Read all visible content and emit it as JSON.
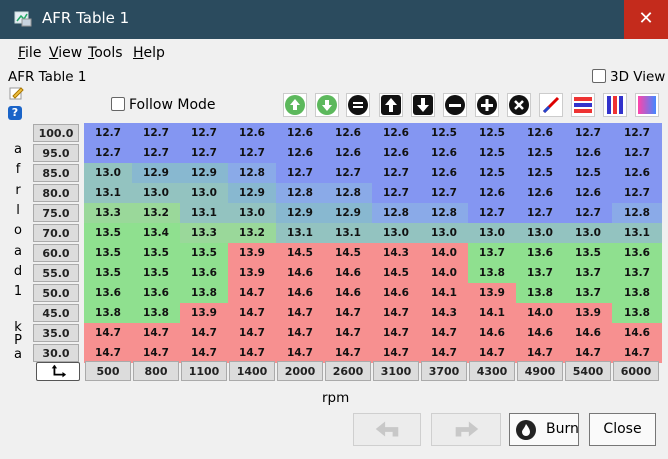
{
  "window": {
    "title": "AFR Table 1",
    "close_glyph": "✕"
  },
  "menu": [
    {
      "label": "File",
      "accel": "F",
      "rest": "ile"
    },
    {
      "label": "View",
      "accel": "V",
      "rest": "iew"
    },
    {
      "label": "Tools",
      "accel": "T",
      "rest": "ools"
    },
    {
      "label": "Help",
      "accel": "H",
      "rest": "elp"
    }
  ],
  "panel": {
    "title": "AFR Table 1",
    "view3d_label": "3D View",
    "follow_mode_label": "Follow Mode"
  },
  "toolbar_icons": [
    "increment-up-icon",
    "increment-down-icon",
    "set-equal-icon",
    "raise-arrow-icon",
    "lower-arrow-icon",
    "minus-icon",
    "plus-icon",
    "multiply-icon",
    "interpolate-icon",
    "interpolate-horizontal-icon",
    "interpolate-vertical-icon",
    "smooth-icon"
  ],
  "y_axis_label_chars": [
    "a",
    "f",
    "r",
    "l",
    "o",
    "a",
    "d",
    "1",
    "",
    "k",
    "P",
    "a"
  ],
  "row_headers": [
    "100.0",
    "95.0",
    "85.0",
    "80.0",
    "75.0",
    "70.0",
    "60.0",
    "55.0",
    "50.0",
    "45.0",
    "35.0",
    "30.0"
  ],
  "col_headers": [
    "500",
    "800",
    "1100",
    "1400",
    "2000",
    "2600",
    "3100",
    "3700",
    "4300",
    "4900",
    "5400",
    "6000"
  ],
  "x_axis_label": "rpm",
  "table": [
    [
      "12.7",
      "12.7",
      "12.7",
      "12.6",
      "12.6",
      "12.6",
      "12.6",
      "12.5",
      "12.5",
      "12.6",
      "12.7",
      "12.7"
    ],
    [
      "12.7",
      "12.7",
      "12.7",
      "12.7",
      "12.6",
      "12.6",
      "12.6",
      "12.6",
      "12.5",
      "12.5",
      "12.6",
      "12.7"
    ],
    [
      "13.0",
      "12.9",
      "12.9",
      "12.8",
      "12.7",
      "12.7",
      "12.7",
      "12.6",
      "12.5",
      "12.5",
      "12.5",
      "12.6"
    ],
    [
      "13.1",
      "13.0",
      "13.0",
      "12.9",
      "12.8",
      "12.8",
      "12.7",
      "12.7",
      "12.6",
      "12.6",
      "12.6",
      "12.7"
    ],
    [
      "13.3",
      "13.2",
      "13.1",
      "13.0",
      "12.9",
      "12.9",
      "12.8",
      "12.8",
      "12.7",
      "12.7",
      "12.7",
      "12.8"
    ],
    [
      "13.5",
      "13.4",
      "13.3",
      "13.2",
      "13.1",
      "13.1",
      "13.0",
      "13.0",
      "13.0",
      "13.0",
      "13.0",
      "13.1"
    ],
    [
      "13.5",
      "13.5",
      "13.5",
      "13.9",
      "14.5",
      "14.5",
      "14.3",
      "14.0",
      "13.7",
      "13.6",
      "13.5",
      "13.6"
    ],
    [
      "13.5",
      "13.5",
      "13.6",
      "13.9",
      "14.6",
      "14.6",
      "14.5",
      "14.0",
      "13.8",
      "13.7",
      "13.7",
      "13.7"
    ],
    [
      "13.6",
      "13.6",
      "13.8",
      "14.7",
      "14.6",
      "14.6",
      "14.6",
      "14.1",
      "13.9",
      "13.8",
      "13.7",
      "13.8"
    ],
    [
      "13.8",
      "13.8",
      "13.9",
      "14.7",
      "14.7",
      "14.7",
      "14.7",
      "14.3",
      "14.1",
      "14.0",
      "13.9",
      "13.8"
    ],
    [
      "14.7",
      "14.7",
      "14.7",
      "14.7",
      "14.7",
      "14.7",
      "14.7",
      "14.7",
      "14.6",
      "14.6",
      "14.6",
      "14.6"
    ],
    [
      "14.7",
      "14.7",
      "14.7",
      "14.7",
      "14.7",
      "14.7",
      "14.7",
      "14.7",
      "14.7",
      "14.7",
      "14.7",
      "14.7"
    ]
  ],
  "buttons": {
    "undo_icon": "undo-icon",
    "redo_icon": "redo-icon",
    "burn_label": "Burn",
    "close_label": "Close"
  },
  "colors": {
    "titlebar": "#2b4b5e",
    "close": "#c42b1c",
    "rich": "#7f96f2",
    "mid": "#8ee08e",
    "lean": "#fa8181"
  }
}
